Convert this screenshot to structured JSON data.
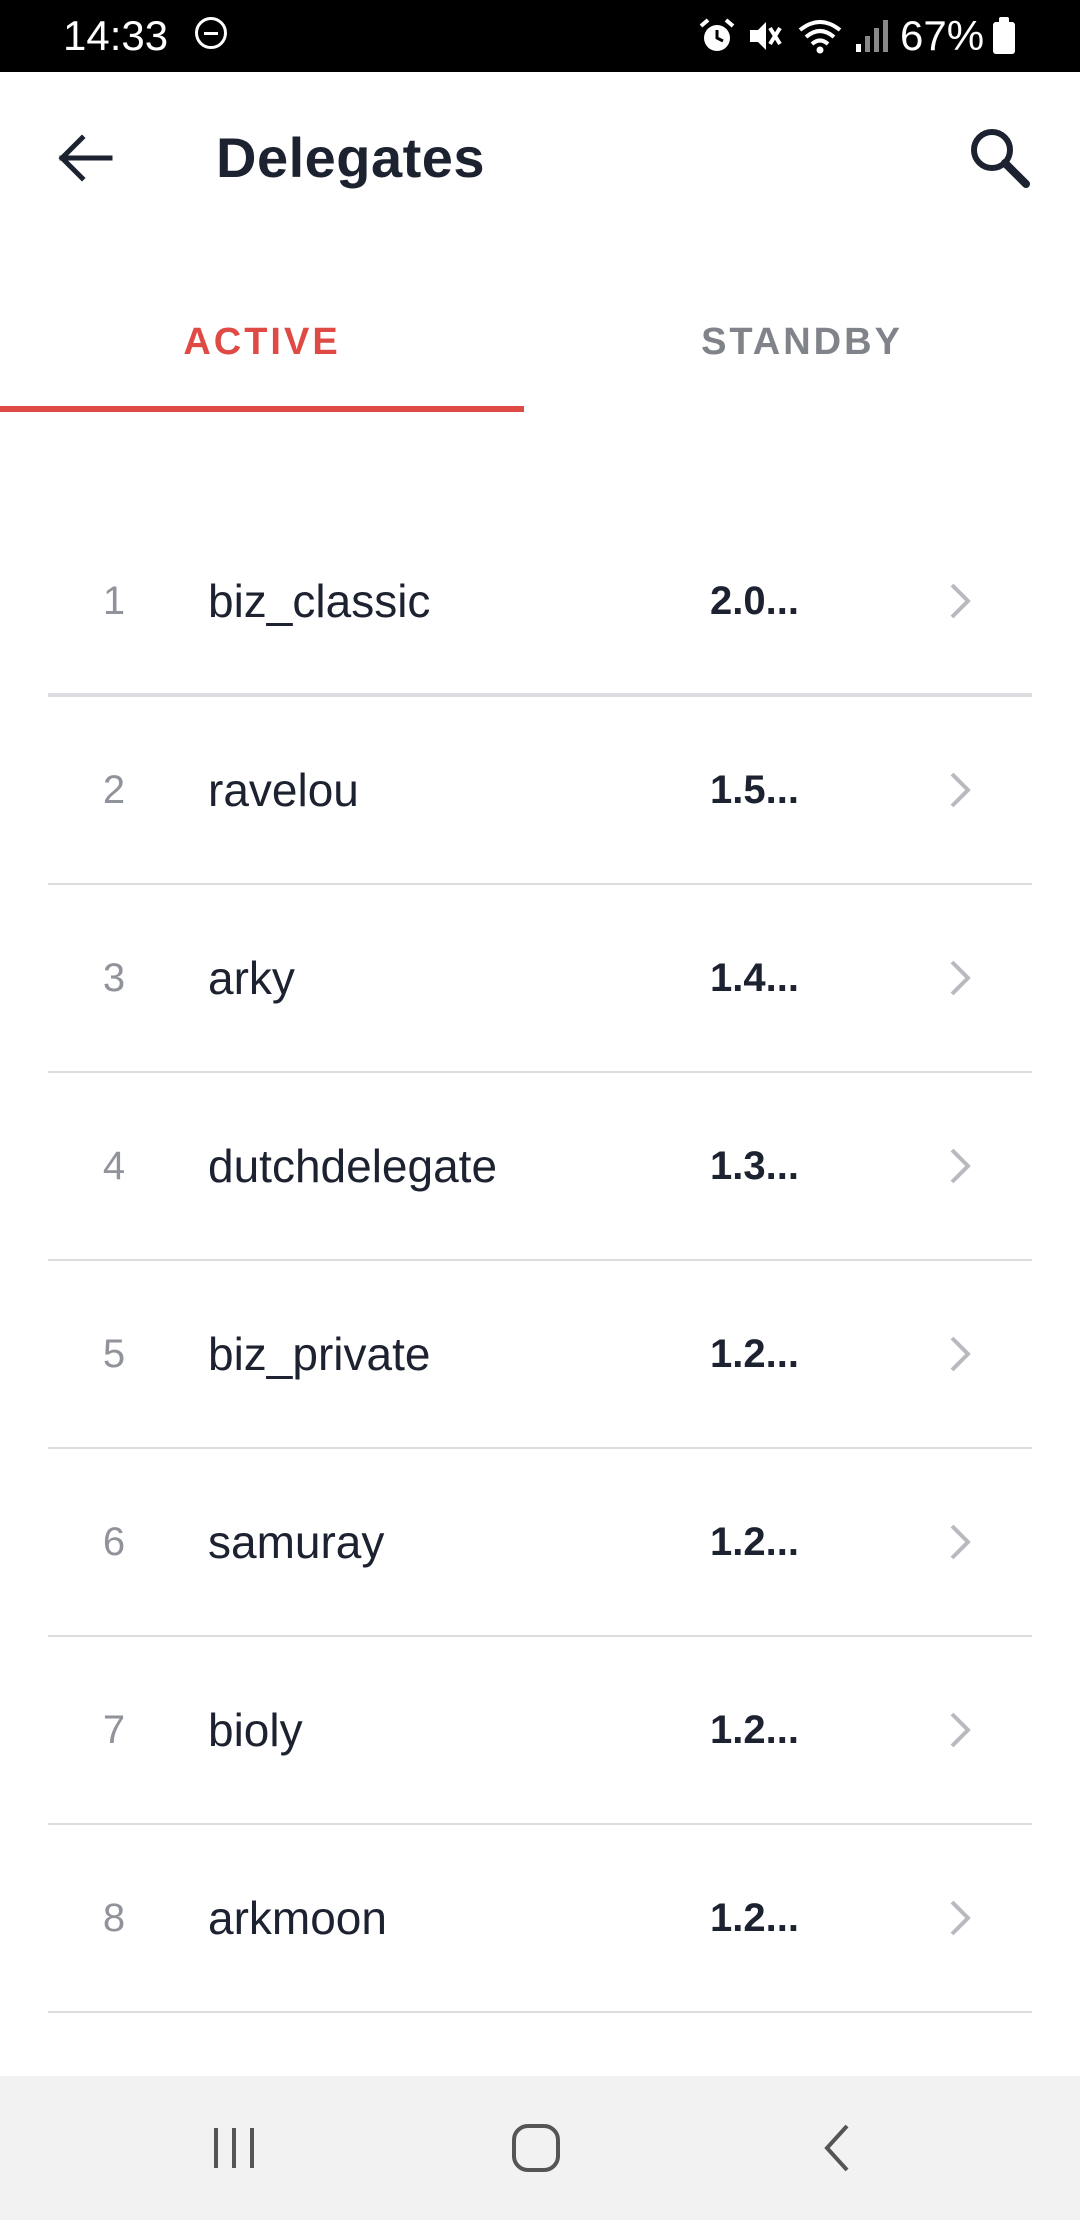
{
  "status_bar": {
    "time": "14:33",
    "battery": "67%",
    "icons": [
      "do-not-disturb-icon",
      "alarm-icon",
      "mute-icon",
      "wifi-icon",
      "signal-icon",
      "battery-icon"
    ]
  },
  "app_bar": {
    "title": "Delegates",
    "back_icon": "arrow-back-icon",
    "search_icon": "search-icon"
  },
  "tabs": [
    {
      "label": "ACTIVE",
      "selected": true
    },
    {
      "label": "STANDBY",
      "selected": false
    }
  ],
  "colors": {
    "accent": "#df4a45",
    "text_primary": "#1d2230",
    "text_muted": "#80838a",
    "divider": "#dcdde0"
  },
  "delegates": [
    {
      "rank": "1",
      "name": "biz_classic",
      "votes": "2.0..."
    },
    {
      "rank": "2",
      "name": "ravelou",
      "votes": "1.5..."
    },
    {
      "rank": "3",
      "name": "arky",
      "votes": "1.4..."
    },
    {
      "rank": "4",
      "name": "dutchdelegate",
      "votes": "1.3..."
    },
    {
      "rank": "5",
      "name": "biz_private",
      "votes": "1.2..."
    },
    {
      "rank": "6",
      "name": "samuray",
      "votes": "1.2..."
    },
    {
      "rank": "7",
      "name": "bioly",
      "votes": "1.2..."
    },
    {
      "rank": "8",
      "name": "arkmoon",
      "votes": "1.2..."
    }
  ],
  "nav_bar": {
    "icons": [
      "recents-icon",
      "home-icon",
      "back-icon"
    ]
  }
}
